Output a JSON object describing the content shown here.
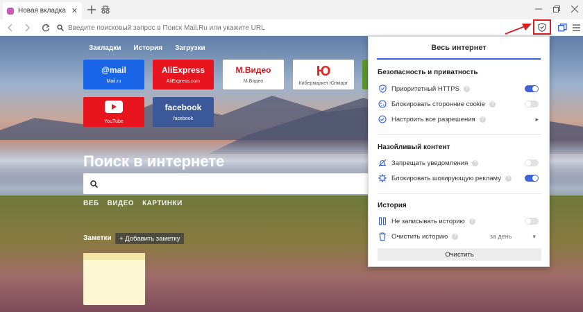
{
  "browser": {
    "tab_title": "Новая вкладка",
    "address_placeholder": "Введите поисковый запрос в Поиск Mail.Ru или укажите URL"
  },
  "page": {
    "topnav": [
      "Закладки",
      "История",
      "Загрузки"
    ],
    "tiles": [
      {
        "logo": "@mail",
        "label": "Mail.ru",
        "bg": "#1a64e8",
        "fg": "#ffffff"
      },
      {
        "logo": "AliExpress",
        "label": "AliExpress.com",
        "bg": "#e8141e",
        "fg": "#ffffff"
      },
      {
        "logo": "М.Видео",
        "label": "М.Видео",
        "bg": "#ffffff",
        "fg": "#d6131c"
      },
      {
        "logo": "Ю",
        "label": "Кибермаркет Юлмарт",
        "bg": "#ffffff",
        "fg": "#e8231e"
      },
      {
        "logo": "YouTube",
        "label": "YouTube",
        "bg": "#e8141e",
        "fg": "#ffffff"
      },
      {
        "logo": "facebook",
        "label": "facebook",
        "bg": "#3b5998",
        "fg": "#ffffff"
      }
    ],
    "search_title": "Поиск в интернете",
    "search_tabs": [
      "ВЕБ",
      "ВИДЕО",
      "КАРТИНКИ"
    ],
    "notes_label": "Заметки",
    "add_note_label": "+ Добавить заметку"
  },
  "popup": {
    "title": "Весь интернет",
    "security": {
      "title": "Безопасность и приватность",
      "https": {
        "label": "Приоритетный HTTPS",
        "on": true
      },
      "cookie": {
        "label": "Блокировать сторонние cookie",
        "on": false
      },
      "permissions": {
        "label": "Настроить все разрешения"
      }
    },
    "annoying": {
      "title": "Назойливый контент",
      "notifications": {
        "label": "Запрещать уведомления",
        "on": false
      },
      "ads": {
        "label": "Блокировать шокирующую рекламу",
        "on": true
      }
    },
    "history": {
      "title": "История",
      "no_history": {
        "label": "Не записывать историю",
        "on": false
      },
      "clear_history": {
        "label": "Очистить историю",
        "period": "за день"
      },
      "clear_button": "Очистить"
    }
  },
  "colors": {
    "accent": "#2f64d8",
    "toggle_on": "#4063d6",
    "annotation": "#d62020"
  }
}
